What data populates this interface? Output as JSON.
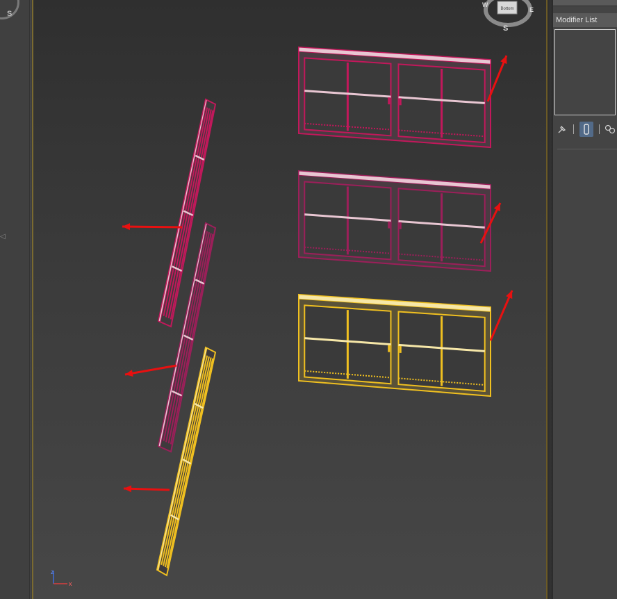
{
  "app": {
    "viewcube": {
      "face_label": "Bottom",
      "compass": [
        "W",
        "E",
        "S"
      ]
    }
  },
  "command_panel": {
    "modifier_list_label": "Modifier List",
    "tools": [
      "pin-stack",
      "show-end-result",
      "make-unique"
    ]
  },
  "viewport": {
    "objects": [
      {
        "name": "window-front-top",
        "color": "#c2185b",
        "selected": false
      },
      {
        "name": "window-front-mid",
        "color": "#9c1f5a",
        "selected": false
      },
      {
        "name": "window-front-bottom",
        "color": "#f0c020",
        "selected": true
      },
      {
        "name": "window-side-top",
        "color": "#c2185b",
        "selected": false
      },
      {
        "name": "window-side-mid",
        "color": "#9c1f5a",
        "selected": false
      },
      {
        "name": "window-side-bottom",
        "color": "#f0c020",
        "selected": true
      }
    ],
    "axis_labels": {
      "z": "z",
      "x": "x"
    },
    "arrow_color": "#e81010"
  },
  "left_strip": {
    "letter": "S",
    "marker": "◁"
  }
}
